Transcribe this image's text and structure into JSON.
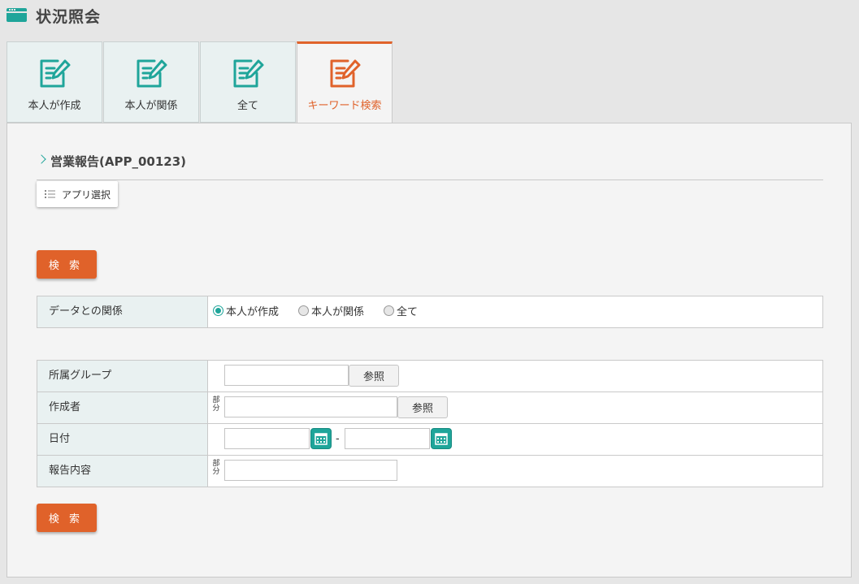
{
  "header": {
    "title": "状況照会",
    "icon": "window-icon"
  },
  "tabs": [
    {
      "label": "本人が作成",
      "icon": "edit-note-icon",
      "active": false
    },
    {
      "label": "本人が関係",
      "icon": "edit-note-icon",
      "active": false
    },
    {
      "label": "全て",
      "icon": "edit-note-icon",
      "active": false
    },
    {
      "label": "キーワード検索",
      "icon": "edit-note-icon",
      "active": true
    }
  ],
  "app": {
    "title": "営業報告(APP_00123)",
    "select_label": "アプリ選択"
  },
  "search_button_label": "検 索",
  "relation": {
    "label": "データとの関係",
    "options": [
      {
        "label": "本人が作成",
        "checked": true
      },
      {
        "label": "本人が関係",
        "checked": false
      },
      {
        "label": "全て",
        "checked": false
      }
    ]
  },
  "fields": {
    "group": {
      "label": "所属グループ",
      "value": "",
      "ref_label": "参照"
    },
    "author": {
      "label": "作成者",
      "value": "",
      "partial_label": "部分",
      "ref_label": "参照"
    },
    "date": {
      "label": "日付",
      "from": "",
      "to": "",
      "separator": "-"
    },
    "content": {
      "label": "報告内容",
      "value": "",
      "partial_label": "部分"
    }
  },
  "colors": {
    "accent": "#e0622a",
    "teal": "#1fa59a",
    "label_bg": "#e9f1f1"
  }
}
